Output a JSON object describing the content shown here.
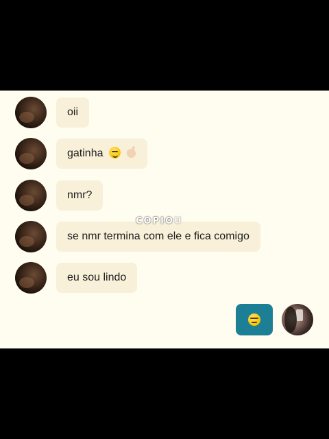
{
  "messages": [
    {
      "text": "oii",
      "emojis": []
    },
    {
      "text": "gatinha",
      "emojis": [
        "smirking-face-emoji",
        "pinching-hand-emoji"
      ]
    },
    {
      "text": "nmr?",
      "emojis": []
    },
    {
      "text": "se nmr termina com ele e fica comigo",
      "emojis": []
    },
    {
      "text": "eu sou lindo",
      "emojis": []
    }
  ],
  "sent_message": {
    "emoji": "expressionless-face-emoji"
  },
  "watermark": {
    "main": "COPIO",
    "faint": "U"
  },
  "colors": {
    "chat_background": "#fffdf0",
    "received_bubble": "#f8f0d9",
    "sent_bubble": "#1d7f95",
    "letterbox": "#000000"
  }
}
